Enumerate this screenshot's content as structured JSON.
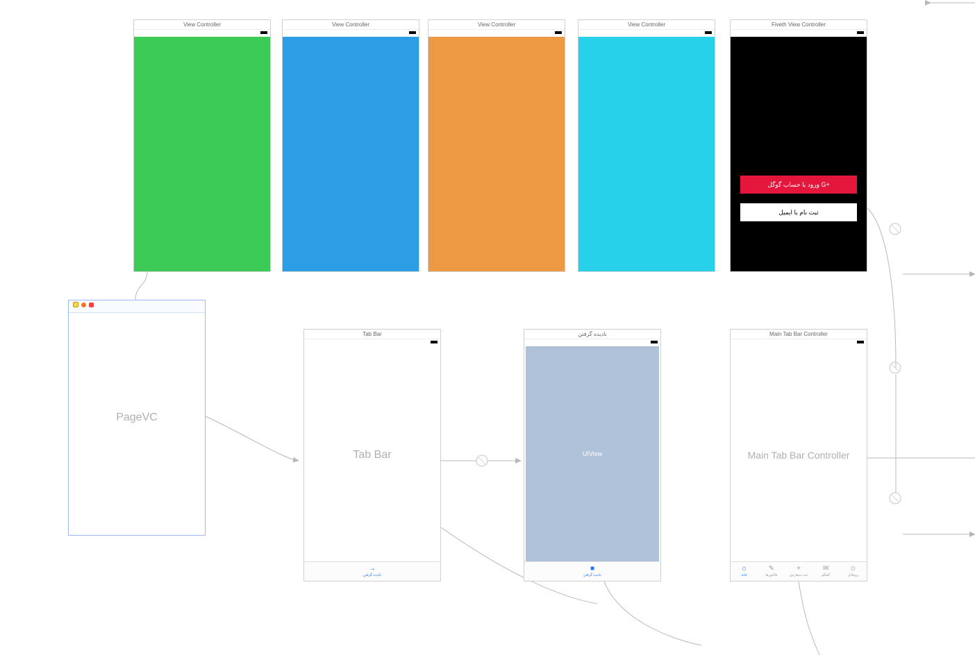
{
  "top_vcs": {
    "vc1": {
      "title": "View Controller"
    },
    "vc2": {
      "title": "View Controller"
    },
    "vc3": {
      "title": "View Controller"
    },
    "vc4": {
      "title": "View Controller"
    },
    "vc5": {
      "title": "Fiveth View Controller",
      "google_button": "ورود با حساب گوگل  G+",
      "email_button": "ثبت نام با ایمیل"
    }
  },
  "bottom": {
    "pagevc": {
      "placeholder": "PageVC"
    },
    "tabbar": {
      "title": "Tab Bar",
      "placeholder": "Tab Bar",
      "tab_label": "نادیده گرفتن",
      "tab_icon": "→"
    },
    "ignore": {
      "title": "نادیده گرفتن",
      "placeholder": "UIView",
      "tab_label": "نادیده گرفتن",
      "tab_icon": "■"
    },
    "maintab": {
      "title": "Main Tab Bar Controller",
      "placeholder": "Main Tab Bar Controller",
      "tabs": [
        {
          "icon": "⌂",
          "label": "خانه",
          "active": true
        },
        {
          "icon": "✎",
          "label": "فاکتورها",
          "active": false
        },
        {
          "icon": "+",
          "label": "ثبت سفارش",
          "active": false
        },
        {
          "icon": "✉",
          "label": "گفتگو",
          "active": false
        },
        {
          "icon": "☺",
          "label": "پروفایل",
          "active": false
        }
      ]
    }
  }
}
